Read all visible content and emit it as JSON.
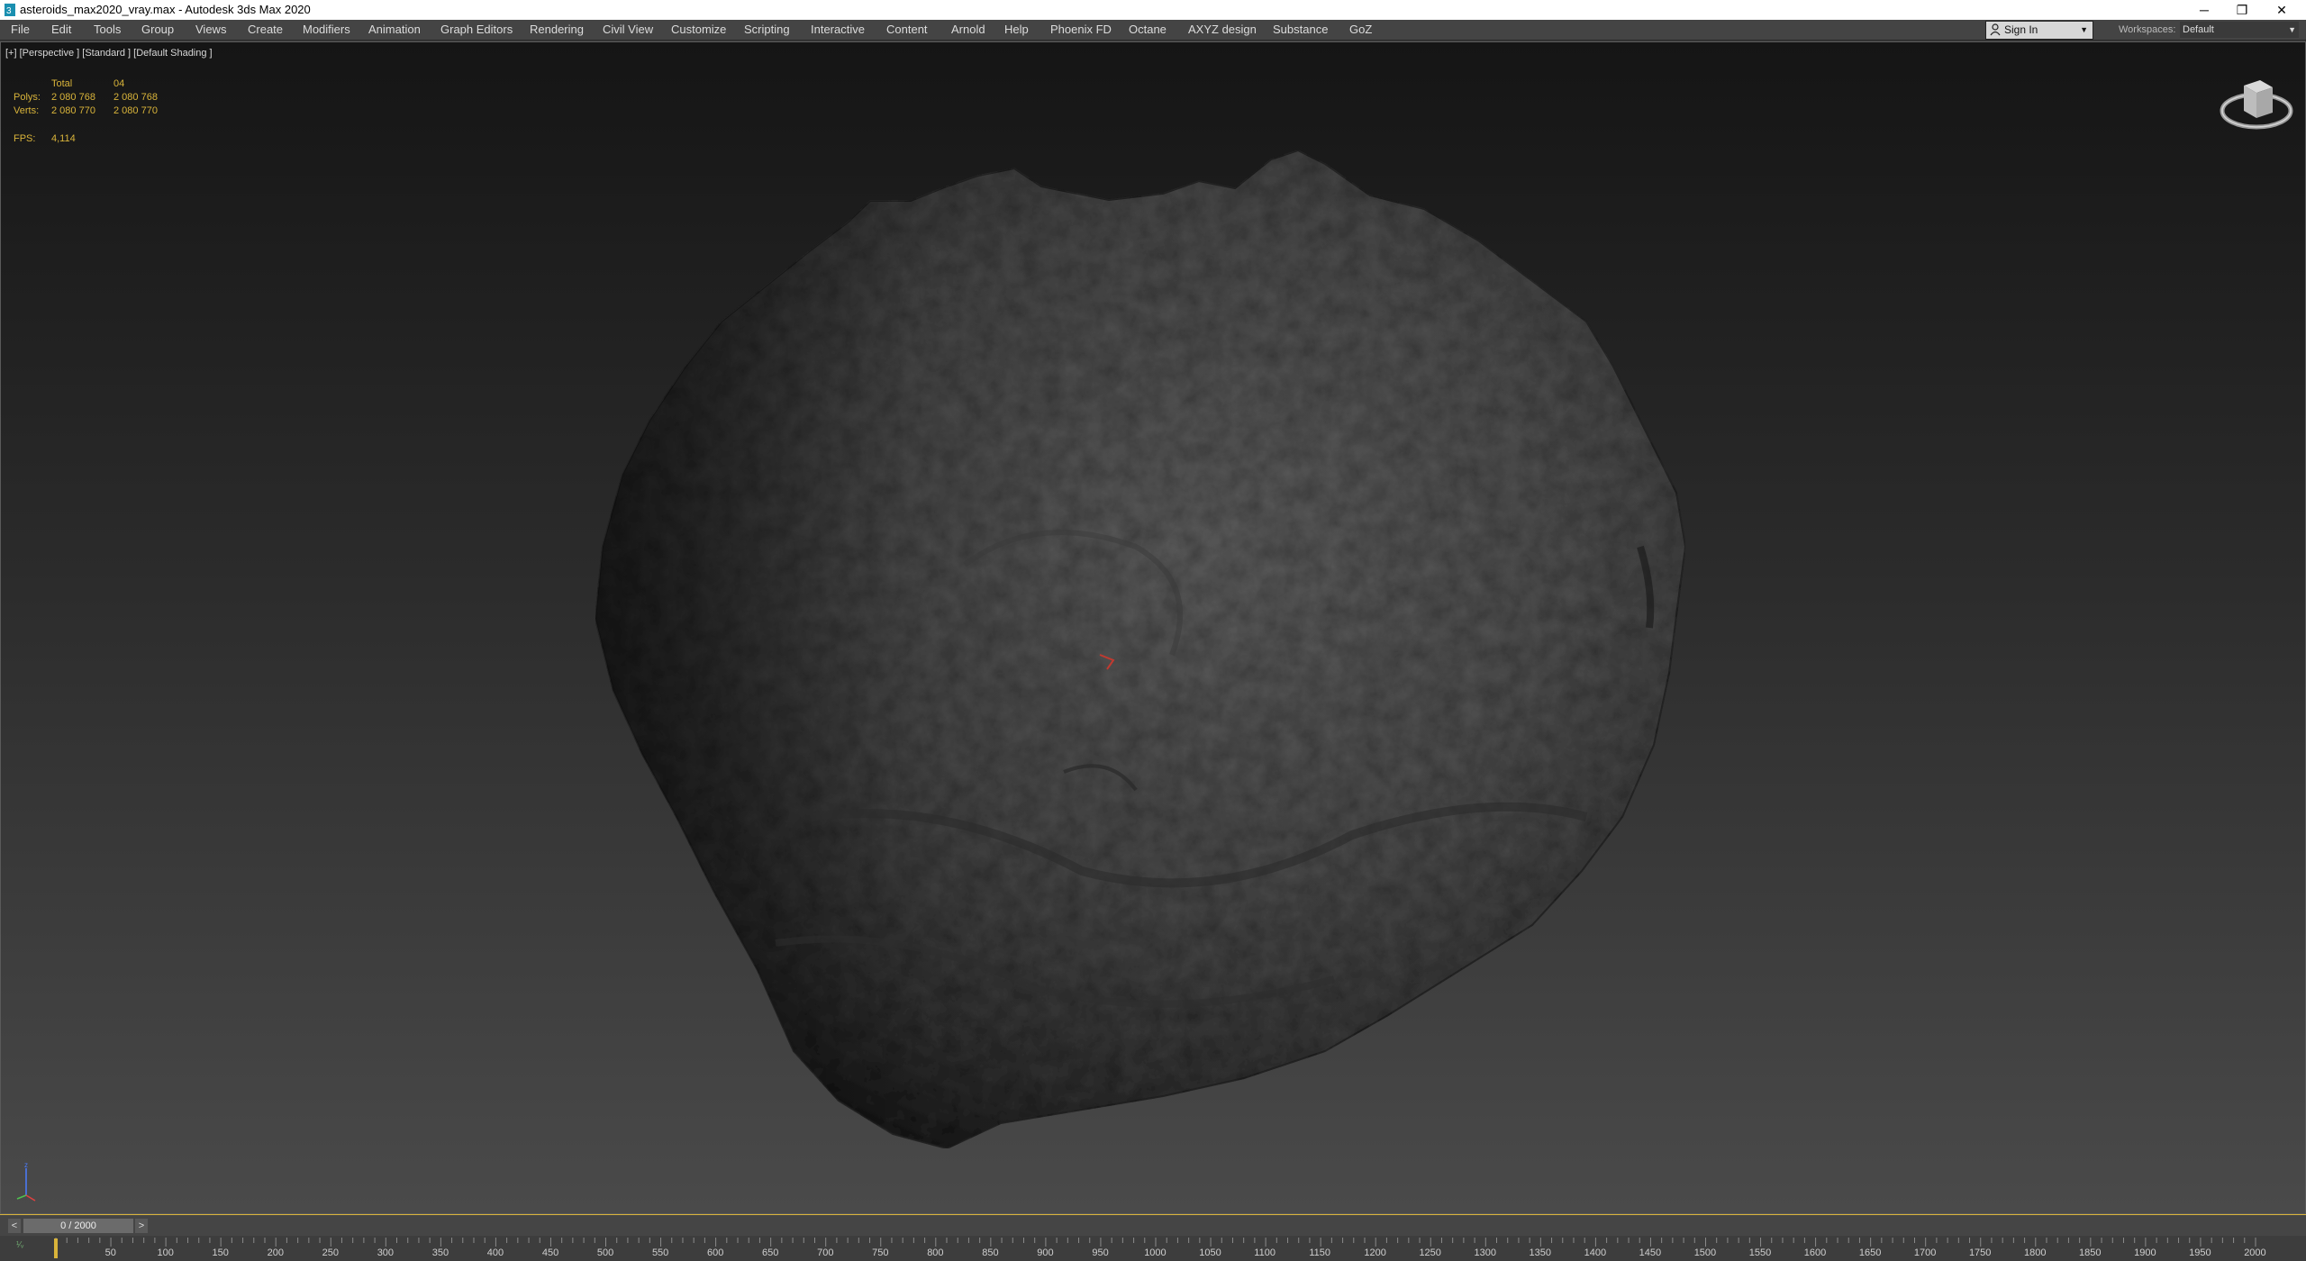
{
  "window": {
    "title": "asteroids_max2020_vray.max - Autodesk 3ds Max 2020",
    "minimize": "─",
    "restore": "❐",
    "close": "✕"
  },
  "menu": [
    "File",
    "Edit",
    "Tools",
    "Group",
    "Views",
    "Create",
    "Modifiers",
    "Animation",
    "Graph Editors",
    "Rendering",
    "Civil View",
    "Customize",
    "Scripting",
    "Interactive",
    "Content",
    "Arnold",
    "Help",
    "Phoenix FD",
    "Octane",
    "AXYZ design",
    "Substance",
    "GoZ"
  ],
  "signin": {
    "label": "Sign In"
  },
  "workspaces": {
    "label": "Workspaces:",
    "value": "Default"
  },
  "viewport": {
    "label": "[+] [Perspective ] [Standard ] [Default Shading ]",
    "stats": {
      "total_label": "Total",
      "object_label": "04",
      "polys_label": "Polys:",
      "polys_total": "2 080 768",
      "polys_object": "2 080 768",
      "verts_label": "Verts:",
      "verts_total": "2 080 770",
      "verts_object": "2 080 770",
      "fps_label": "FPS:",
      "fps_value": "4,114"
    }
  },
  "timeslider": {
    "prev": "<",
    "next": ">",
    "value": "0 / 2000"
  },
  "trackbar": {
    "key_label": "¹⁄ᵥ",
    "ticks": [
      "50",
      "100",
      "150",
      "200",
      "250",
      "300",
      "350",
      "400",
      "450",
      "500",
      "550",
      "600",
      "650",
      "700",
      "750",
      "800",
      "850",
      "900",
      "950",
      "1000",
      "1050",
      "1100",
      "1150",
      "1200",
      "1250",
      "1300",
      "1350",
      "1400",
      "1450",
      "1500",
      "1550",
      "1600",
      "1650",
      "1700",
      "1750",
      "1800",
      "1850",
      "1900",
      "1950",
      "2000"
    ]
  }
}
